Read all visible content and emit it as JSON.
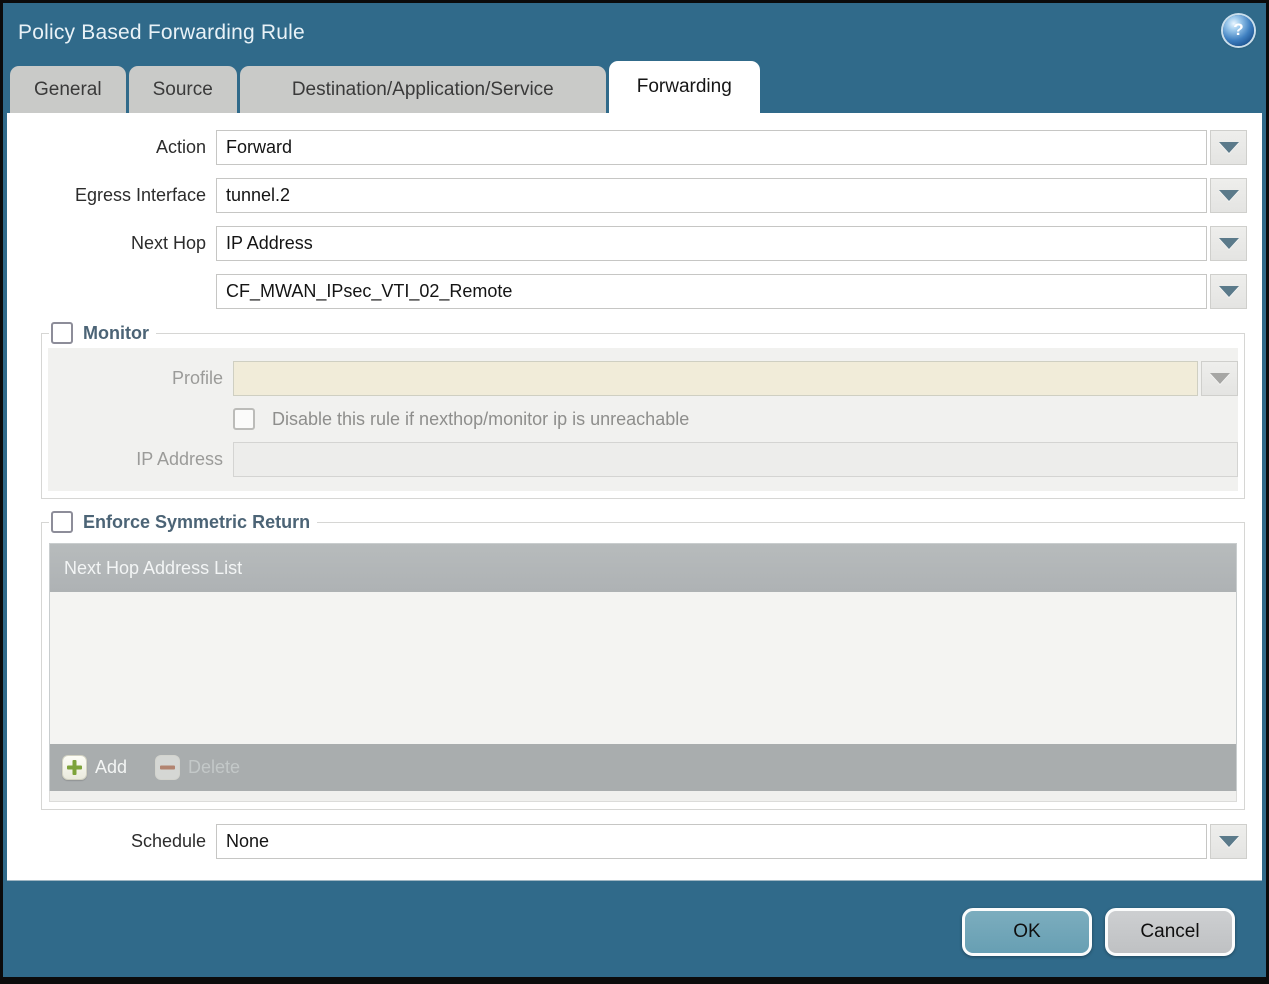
{
  "window": {
    "title": "Policy Based Forwarding Rule"
  },
  "tabs": [
    {
      "label": "General",
      "active": false
    },
    {
      "label": "Source",
      "active": false
    },
    {
      "label": "Destination/Application/Service",
      "active": false
    },
    {
      "label": "Forwarding",
      "active": true
    }
  ],
  "help": {
    "glyph": "?"
  },
  "form": {
    "action": {
      "label": "Action",
      "value": "Forward"
    },
    "egress_interface": {
      "label": "Egress Interface",
      "value": "tunnel.2"
    },
    "next_hop": {
      "label": "Next Hop",
      "value": "IP Address"
    },
    "next_hop_address": {
      "value": "CF_MWAN_IPsec_VTI_02_Remote"
    },
    "schedule": {
      "label": "Schedule",
      "value": "None"
    }
  },
  "monitor": {
    "legend": "Monitor",
    "checked": false,
    "profile": {
      "label": "Profile",
      "value": ""
    },
    "disable_rule": {
      "label": "Disable this rule if nexthop/monitor ip is unreachable",
      "checked": false
    },
    "ip_address": {
      "label": "IP Address",
      "value": ""
    }
  },
  "symmetric_return": {
    "legend": "Enforce Symmetric Return",
    "checked": false,
    "table": {
      "header": "Next Hop Address List",
      "rows": []
    },
    "add_label": "Add",
    "delete_label": "Delete",
    "delete_enabled": false
  },
  "footer": {
    "ok_label": "OK",
    "cancel_label": "Cancel"
  },
  "colors": {
    "background_teal": "#306a8a",
    "tab_gray": "#c9cac8",
    "panel_gray": "#f1f1ef",
    "profile_beige": "#f1ecd9",
    "grid_header_gray": "#b2b6b7",
    "grid_footer_gray": "#a9adae",
    "ok_button_teal": "#6ea6b9",
    "cancel_button_gray": "#c5c7c9",
    "legend_slate": "#4c6476",
    "add_plus_green": "#7da33a",
    "delete_minus_red": "#b28470"
  }
}
